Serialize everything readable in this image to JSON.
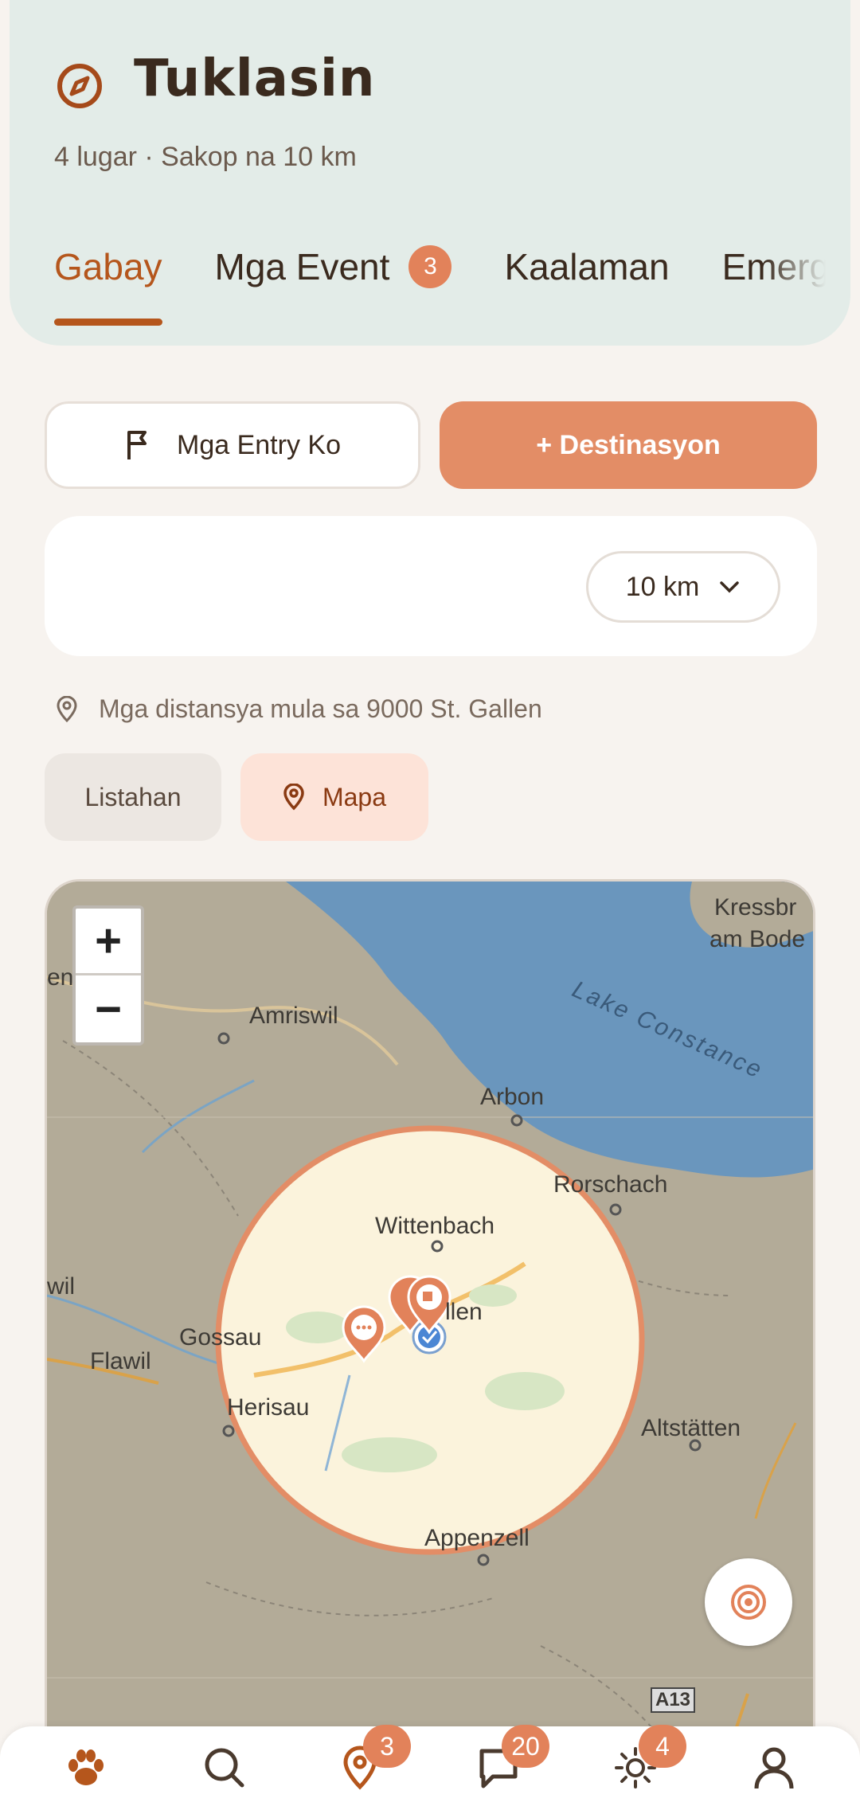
{
  "header": {
    "title": "Tuklasin",
    "subtitle": "4 lugar · Sakop na 10 km",
    "tabs": [
      {
        "label": "Gabay",
        "active": true
      },
      {
        "label": "Mga Event",
        "badge": "3"
      },
      {
        "label": "Kaalaman"
      },
      {
        "label": "Emerg"
      }
    ]
  },
  "actions": {
    "entries_label": "Mga Entry Ko",
    "destination_label": "+ Destinasyon"
  },
  "filter": {
    "radius_value": "10 km"
  },
  "distance_note": "Mga distansya mula sa 9000 St. Gallen",
  "view_toggle": {
    "list_label": "Listahan",
    "map_label": "Mapa"
  },
  "map": {
    "zoom_in": "+",
    "zoom_out": "−",
    "labels": {
      "kressbronn": "Kressbr",
      "am_bodensee": "am Bode",
      "amriswil": "Amriswil",
      "arbon": "Arbon",
      "lake": "Lake Constance",
      "rorschach": "Rorschach",
      "wittenbach": "Wittenbach",
      "gallen": "llen",
      "gossau": "Gossau",
      "flawil": "Flawil",
      "wil": "wil",
      "herisau": "Herisau",
      "altstatten": "Altstätten",
      "appenzell": "Appenzell",
      "a13": "A13",
      "en": "en"
    },
    "colors": {
      "circle_fill": "#fbf3dc",
      "circle_stroke": "#e38d66",
      "lake": "#6a96bd",
      "marker": "#e2825a"
    }
  },
  "bottom_nav": {
    "items": [
      {
        "icon": "paw-icon"
      },
      {
        "icon": "search-icon"
      },
      {
        "icon": "map-pin-icon",
        "badge": "3"
      },
      {
        "icon": "chat-icon",
        "badge": "20"
      },
      {
        "icon": "sun-icon",
        "badge": "4"
      },
      {
        "icon": "profile-icon"
      }
    ]
  }
}
